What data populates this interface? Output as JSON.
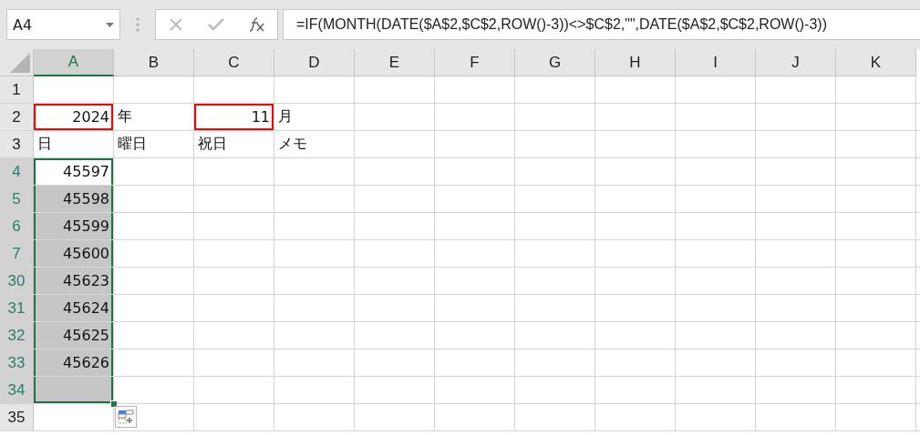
{
  "name_box": {
    "value": "A4"
  },
  "formula_bar": {
    "value": "=IF(MONTH(DATE($A$2,$C$2,ROW()-3))<>$C$2,\"\",DATE($A$2,$C$2,ROW()-3))"
  },
  "columns": [
    {
      "label": "A",
      "selected": true
    },
    {
      "label": "B",
      "selected": false
    },
    {
      "label": "C",
      "selected": false
    },
    {
      "label": "D",
      "selected": false
    },
    {
      "label": "E",
      "selected": false
    },
    {
      "label": "F",
      "selected": false
    },
    {
      "label": "G",
      "selected": false
    },
    {
      "label": "H",
      "selected": false
    },
    {
      "label": "I",
      "selected": false
    },
    {
      "label": "J",
      "selected": false
    },
    {
      "label": "K",
      "selected": false
    }
  ],
  "rows": [
    {
      "header": "1",
      "selected": false,
      "cells": []
    },
    {
      "header": "2",
      "selected": false,
      "cells": [
        {
          "kind": "number",
          "text": "2024",
          "selected": false,
          "highlighted": true
        },
        {
          "kind": "text",
          "text": "年",
          "selected": false,
          "highlighted": false
        },
        {
          "kind": "number",
          "text": "11",
          "selected": false,
          "highlighted": true
        },
        {
          "kind": "text",
          "text": "月",
          "selected": false,
          "highlighted": false
        }
      ]
    },
    {
      "header": "3",
      "selected": false,
      "cells": [
        {
          "kind": "text",
          "text": "日",
          "selected": false,
          "highlighted": false
        },
        {
          "kind": "text",
          "text": "曜日",
          "selected": false,
          "highlighted": false
        },
        {
          "kind": "text",
          "text": "祝日",
          "selected": false,
          "highlighted": false
        },
        {
          "kind": "text",
          "text": "メモ",
          "selected": false,
          "highlighted": false
        }
      ]
    },
    {
      "header": "4",
      "selected": true,
      "cells": [
        {
          "kind": "number",
          "text": "45597",
          "selected": true,
          "active": true,
          "highlighted": false
        }
      ]
    },
    {
      "header": "5",
      "selected": true,
      "cells": [
        {
          "kind": "number",
          "text": "45598",
          "selected": true,
          "active": false,
          "highlighted": false
        }
      ]
    },
    {
      "header": "6",
      "selected": true,
      "cells": [
        {
          "kind": "number",
          "text": "45599",
          "selected": true,
          "active": false,
          "highlighted": false
        }
      ]
    },
    {
      "header": "7",
      "selected": true,
      "cells": [
        {
          "kind": "number",
          "text": "45600",
          "selected": true,
          "active": false,
          "highlighted": false
        }
      ]
    },
    {
      "header": "30",
      "selected": true,
      "cells": [
        {
          "kind": "number",
          "text": "45623",
          "selected": true,
          "active": false,
          "highlighted": false
        }
      ]
    },
    {
      "header": "31",
      "selected": true,
      "cells": [
        {
          "kind": "number",
          "text": "45624",
          "selected": true,
          "active": false,
          "highlighted": false
        }
      ]
    },
    {
      "header": "32",
      "selected": true,
      "cells": [
        {
          "kind": "number",
          "text": "45625",
          "selected": true,
          "active": false,
          "highlighted": false
        }
      ]
    },
    {
      "header": "33",
      "selected": true,
      "cells": [
        {
          "kind": "number",
          "text": "45626",
          "selected": true,
          "active": false,
          "highlighted": false
        }
      ]
    },
    {
      "header": "34",
      "selected": true,
      "cells": [
        {
          "kind": "blank",
          "selected": true,
          "active": false,
          "highlighted": false
        }
      ]
    },
    {
      "header": "35",
      "selected": false,
      "cells": []
    }
  ]
}
